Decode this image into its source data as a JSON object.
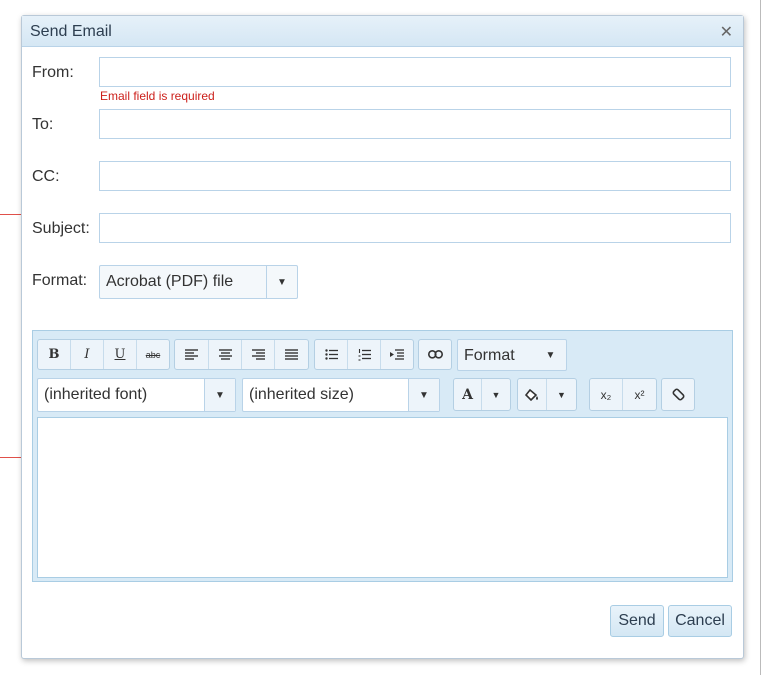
{
  "dialog": {
    "title": "Send Email",
    "close_icon": "close-icon"
  },
  "form": {
    "from_label": "From:",
    "from_value": "",
    "from_error": "Email field is required",
    "to_label": "To:",
    "to_value": "",
    "cc_label": "CC:",
    "cc_value": "",
    "subject_label": "Subject:",
    "subject_value": "",
    "format_label": "Format:",
    "format_value": "Acrobat (PDF) file"
  },
  "editor": {
    "bold": "B",
    "italic": "I",
    "underline": "U",
    "strike": "abc",
    "format_select": "Format",
    "font_select": "(inherited font)",
    "size_select": "(inherited size)",
    "font_color": "A",
    "subscript": "x₂",
    "superscript": "x²",
    "arrow": "▼"
  },
  "footer": {
    "send": "Send",
    "cancel": "Cancel"
  },
  "colors": {
    "error": "#cc1f1a",
    "titlebar": "#d5e7f4",
    "border": "#b9d3e8"
  }
}
